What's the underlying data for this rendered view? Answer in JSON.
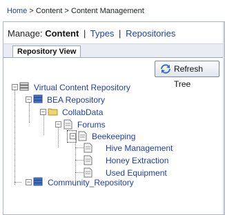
{
  "breadcrumb": {
    "home": "Home",
    "sep1": ">",
    "content": "Content",
    "sep2": ">",
    "current": "Content Management"
  },
  "manage": {
    "prefix": "Manage:",
    "current": "Content",
    "pipe1": "|",
    "types": "Types",
    "pipe2": "|",
    "repositories": "Repositories"
  },
  "tabs": {
    "repository_view": "Repository View"
  },
  "toolbar": {
    "refresh_label": "Refresh Tree"
  },
  "tree": {
    "root": "Virtual Content Repository",
    "bea": "BEA Repository",
    "collab": "CollabData",
    "forums": "Forums",
    "beekeeping": "Beekeeping",
    "hive": "Hive Management",
    "honey": "Honey Extraction",
    "used": "Used Equipment",
    "community": "Community_Repository"
  },
  "colors": {
    "link": "#1f3fa8",
    "folder": "#f2d36b",
    "repo": "#4a78c8"
  }
}
